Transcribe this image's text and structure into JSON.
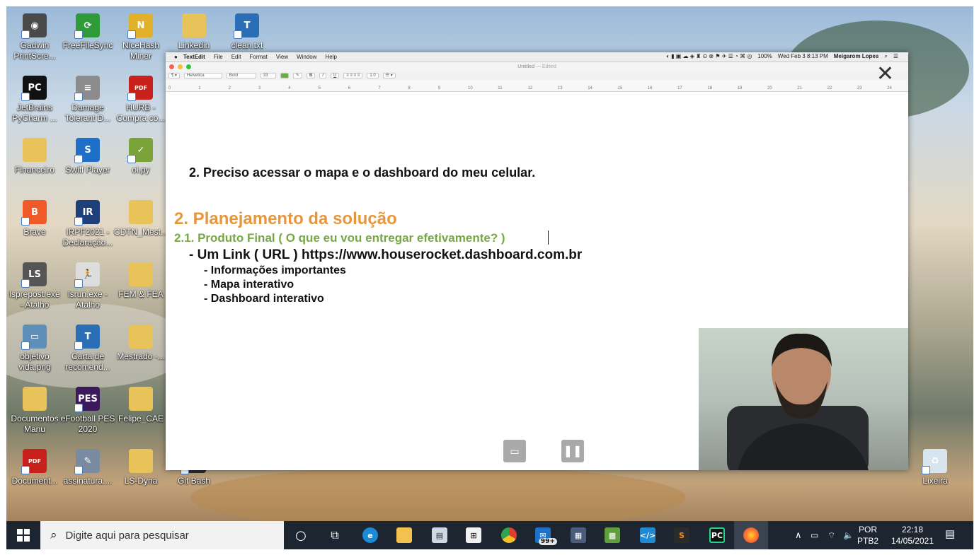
{
  "desktop": {
    "icons": [
      {
        "label": "Gadwin\nPrintScre...",
        "icon": "camera-icon",
        "color": "#4a4a4a",
        "glyph": "◉"
      },
      {
        "label": "FreeFileSync",
        "icon": "sync-icon",
        "color": "#2f9a3a",
        "glyph": "⟳"
      },
      {
        "label": "NiceHash\nMiner",
        "icon": "nicehash-icon",
        "color": "#e3b02a",
        "glyph": "N"
      },
      {
        "label": "Linkedin\nLearning",
        "icon": "folder-icon",
        "color": "#e8c35a",
        "glyph": ""
      },
      {
        "label": "clean.txt",
        "icon": "text-file-icon",
        "color": "#2a6eb5",
        "glyph": "T"
      },
      {
        "label": "JetBrains\nPyCharm ...",
        "icon": "pycharm-icon",
        "color": "#111111",
        "glyph": "PC"
      },
      {
        "label": "Damage\nTolerant D...",
        "icon": "document-image-icon",
        "color": "#8c8c8c",
        "glyph": "≡"
      },
      {
        "label": "HURB -\nCompra co...",
        "icon": "pdf-icon",
        "color": "#c8201a",
        "glyph": "PDF"
      },
      {
        "label": "Financeiro",
        "icon": "folder-zip-icon",
        "color": "#e8c35a",
        "glyph": ""
      },
      {
        "label": "Swiff Player",
        "icon": "swiff-player-icon",
        "color": "#1e6fc8",
        "glyph": "S"
      },
      {
        "label": "oi.py",
        "icon": "python-file-icon",
        "color": "#7aa33a",
        "glyph": "✓"
      },
      {
        "label": "Brave",
        "icon": "brave-icon",
        "color": "#f05a28",
        "glyph": "B"
      },
      {
        "label": "IRPF2021 -\nDeclaração...",
        "icon": "irpf-icon",
        "color": "#1f3f7a",
        "glyph": "IR"
      },
      {
        "label": "CDTN_Mest...",
        "icon": "folder-zip-icon",
        "color": "#e8c35a",
        "glyph": ""
      },
      {
        "label": "lsprepost.exe\n- Atalho",
        "icon": "lsprepost-icon",
        "color": "#555555",
        "glyph": "LS"
      },
      {
        "label": "lsrun.exe -\nAtalho",
        "icon": "lsrun-icon",
        "color": "#dddddd",
        "glyph": "🏃"
      },
      {
        "label": "FEM & FEA",
        "icon": "folder-zip-icon",
        "color": "#e8c35a",
        "glyph": ""
      },
      {
        "label": "objetivo\nvida.png",
        "icon": "image-file-icon",
        "color": "#5d8fb8",
        "glyph": "▭"
      },
      {
        "label": "Carta de\nrecomend...",
        "icon": "text-file-icon",
        "color": "#2a6eb5",
        "glyph": "T"
      },
      {
        "label": "Mestrado -...",
        "icon": "folder-zip-icon",
        "color": "#e8c35a",
        "glyph": ""
      },
      {
        "label": "Documentos\nManu",
        "icon": "folder-zip-icon",
        "color": "#e8c35a",
        "glyph": ""
      },
      {
        "label": "eFootball PES\n2020",
        "icon": "pes-icon",
        "color": "#3a1a5a",
        "glyph": "PES"
      },
      {
        "label": "Felipe_CAE",
        "icon": "folder-zip-icon",
        "color": "#e8c35a",
        "glyph": ""
      },
      {
        "label": "Document...",
        "icon": "pdf-icon",
        "color": "#c8201a",
        "glyph": "PDF"
      },
      {
        "label": "assinatura....",
        "icon": "image-file-icon",
        "color": "#7a8aa0",
        "glyph": "✎"
      },
      {
        "label": "LS-Dyna",
        "icon": "folder-zip-icon",
        "color": "#e8c35a",
        "glyph": ""
      },
      {
        "label": "Git Bash",
        "icon": "git-bash-icon",
        "color": "#2b2b2b",
        "glyph": ""
      },
      {
        "label": "Lixeira",
        "icon": "recycle-bin-icon",
        "color": "#d8e4ee",
        "glyph": "♻"
      }
    ]
  },
  "mac": {
    "menu": [
      "TextEdit",
      "File",
      "Edit",
      "Format",
      "View",
      "Window",
      "Help"
    ],
    "status_right": [
      "100%",
      "Wed Feb 3  8:13 PM",
      "Meigarom Lopes"
    ],
    "window_title": "Untitled",
    "window_state": "— Edited",
    "font_name": "Helvetica",
    "font_style": "Bold",
    "font_size": "33",
    "line_spacing": "1.0",
    "ruler_ticks": [
      "0",
      "1",
      "2",
      "3",
      "4",
      "5",
      "6",
      "7",
      "8",
      "9",
      "10",
      "11",
      "12",
      "13",
      "14",
      "15",
      "16",
      "17",
      "18",
      "19",
      "20",
      "21",
      "22",
      "23",
      "24"
    ]
  },
  "document": {
    "line1": "2. Preciso acessar o mapa e o dashboard do meu celular.",
    "heading": "2. Planejamento da solução",
    "subheading": "2.1. Produto Final ( O que eu vou entregar efetivamente? )",
    "link_line": "- Um Link ( URL ) https://www.houserocket.dashboard.com.br",
    "bullets": [
      "- Informações importantes",
      "- Mapa interativo",
      "- Dashboard interativo"
    ],
    "heading_color": "#e8963c",
    "subheading_color": "#76a843"
  },
  "taskbar": {
    "search_placeholder": "Digite aqui para pesquisar",
    "mail_badge": "99+",
    "language": "POR",
    "keyboard": "PTB2",
    "time": "22:18",
    "date": "14/05/2021"
  }
}
